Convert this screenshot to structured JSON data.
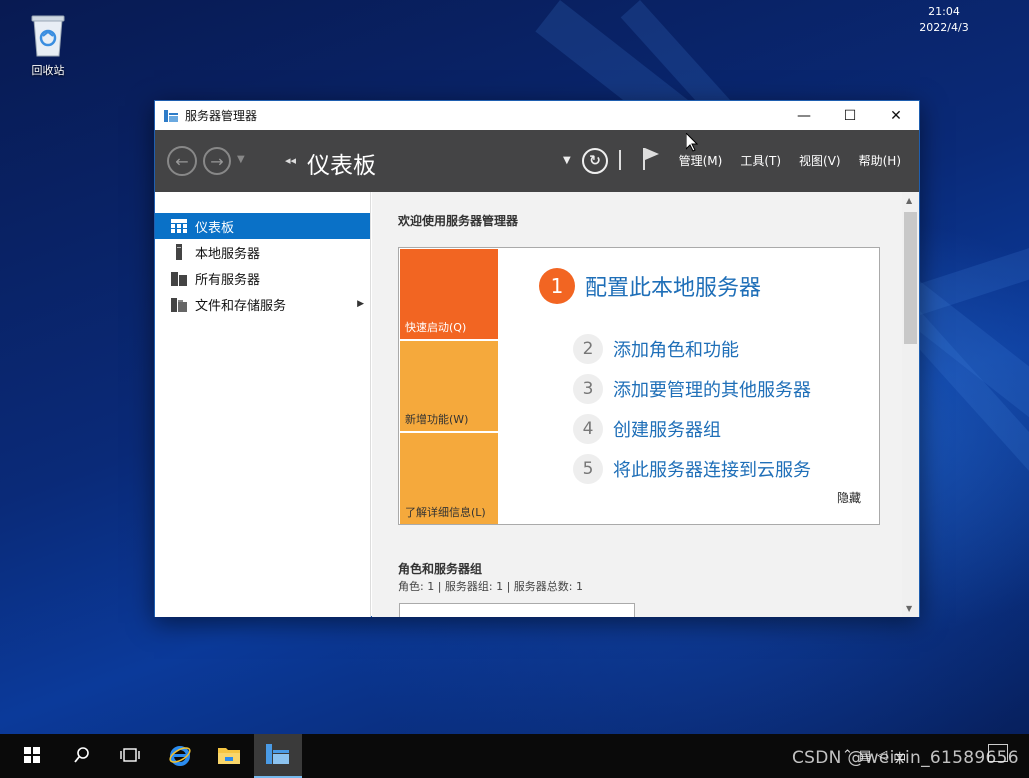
{
  "desktop": {
    "recycle_bin_label": "回收站"
  },
  "window": {
    "title": "服务器管理器",
    "controls": {
      "minimize": "—",
      "maximize": "☐",
      "close": "✕"
    }
  },
  "toolbar": {
    "breadcrumb": "仪表板",
    "menus": [
      "管理(M)",
      "工具(T)",
      "视图(V)",
      "帮助(H)"
    ]
  },
  "sidebar": {
    "items": [
      {
        "label": "仪表板",
        "icon": "dashboard-icon",
        "active": true
      },
      {
        "label": "本地服务器",
        "icon": "server-icon"
      },
      {
        "label": "所有服务器",
        "icon": "servers-icon"
      },
      {
        "label": "文件和存储服务",
        "icon": "storage-icon",
        "has_submenu": true
      }
    ]
  },
  "main": {
    "welcome": "欢迎使用服务器管理器",
    "tiles": [
      "快速启动(Q)",
      "新增功能(W)",
      "了解详细信息(L)"
    ],
    "steps": [
      {
        "num": "1",
        "label": "配置此本地服务器"
      },
      {
        "num": "2",
        "label": "添加角色和功能"
      },
      {
        "num": "3",
        "label": "添加要管理的其他服务器"
      },
      {
        "num": "4",
        "label": "创建服务器组"
      },
      {
        "num": "5",
        "label": "将此服务器连接到云服务"
      }
    ],
    "hide_label": "隐藏",
    "roles_title": "角色和服务器组",
    "roles_summary": "角色: 1 | 服务器组: 1 | 服务器总数: 1"
  },
  "taskbar": {
    "time": "21:04",
    "date": "2022/4/3",
    "watermark": "CSDN @weixin_61589656"
  },
  "colors": {
    "accent": "#0a71c7",
    "quickstart_orange": "#f26522",
    "tile_amber": "#f5a93c",
    "link_blue": "#1f6fb8",
    "toolbar_gray": "#444445"
  }
}
